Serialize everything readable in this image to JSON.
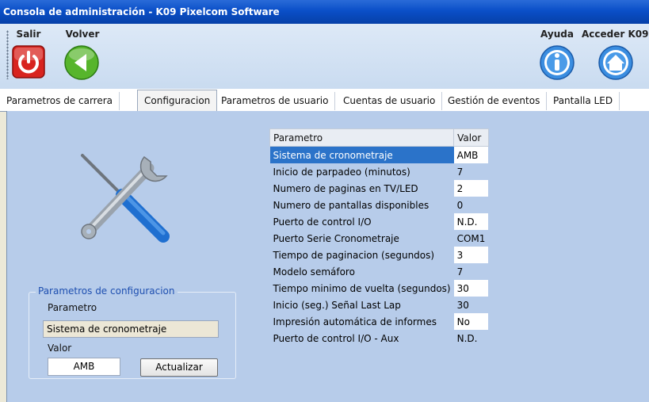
{
  "window": {
    "title": "Consola de administración - K09 Pixelcom Software"
  },
  "toolbar": {
    "exit_label": "Salir",
    "back_label": "Volver",
    "help_label": "Ayuda",
    "access_label": "Acceder K09"
  },
  "tabs": [
    {
      "label": "Parametros de carrera"
    },
    {
      "label": "Configuracion",
      "active": true
    },
    {
      "label": "Parametros de usuario"
    },
    {
      "label": "Cuentas de usuario"
    },
    {
      "label": "Gestión de eventos"
    },
    {
      "label": "Pantalla LED"
    }
  ],
  "grid": {
    "columns": [
      "Parametro",
      "Valor"
    ],
    "rows": [
      {
        "param": "Sistema de cronometraje",
        "value": "AMB"
      },
      {
        "param": "Inicio de parpadeo (minutos)",
        "value": "7"
      },
      {
        "param": "Numero de paginas en TV/LED",
        "value": "2"
      },
      {
        "param": "Numero de pantallas disponibles",
        "value": "0"
      },
      {
        "param": "Puerto de control I/O",
        "value": "N.D."
      },
      {
        "param": "Puerto Serie Cronometraje",
        "value": "COM1"
      },
      {
        "param": "Tiempo de paginacion (segundos)",
        "value": "3"
      },
      {
        "param": "Modelo semáforo",
        "value": "7"
      },
      {
        "param": "Tiempo minimo de vuelta (segundos)",
        "value": "30"
      },
      {
        "param": "Inicio (seg.) Señal Last Lap",
        "value": "30"
      },
      {
        "param": "Impresión automática de informes",
        "value": "No"
      },
      {
        "param": "Puerto de control I/O - Aux",
        "value": "N.D."
      }
    ]
  },
  "config_group": {
    "title": "Parametros de configuracion",
    "param_label": "Parametro",
    "param_value": "Sistema de cronometraje",
    "value_label": "Valor",
    "value_value": "AMB",
    "update_label": "Actualizar"
  },
  "colors": {
    "titlebar": "#0a4fc8",
    "panel": "#b7ccea",
    "selection": "#2b73c9",
    "group_title": "#1e4fb0"
  },
  "icons": [
    "power-icon",
    "back-arrow-icon",
    "info-icon",
    "home-icon",
    "tools-icon"
  ]
}
